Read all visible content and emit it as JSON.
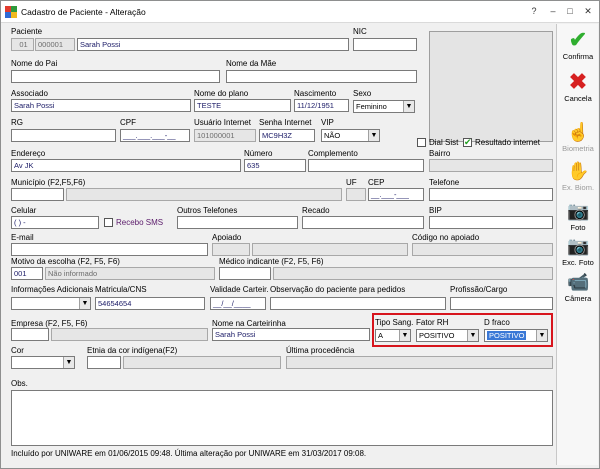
{
  "window": {
    "title": "Cadastro de Paciente - Alteração",
    "help": "?",
    "minimize": "–",
    "maximize": "□",
    "close": "✕"
  },
  "labels": {
    "paciente": "Paciente",
    "nic": "NIC",
    "nome_pai": "Nome do Pai",
    "nome_mae": "Nome da Mãe",
    "associado": "Associado",
    "nome_plano": "Nome do plano",
    "nascimento": "Nascimento",
    "sexo": "Sexo",
    "rg": "RG",
    "cpf": "CPF",
    "usuario_internet": "Usuário Internet",
    "senha_internet": "Senha Internet",
    "vip": "VIP",
    "dial_sist": "Dial Sist",
    "resultado_internet": "Resultado internet",
    "endereco": "Endereço",
    "numero": "Número",
    "complemento": "Complemento",
    "bairro": "Bairro",
    "municipio": "Município (F2,F5,F6)",
    "uf": "UF",
    "cep": "CEP",
    "telefone": "Telefone",
    "celular": "Celular",
    "recebo_sms": "Recebo SMS",
    "outros_telefones": "Outros Telefones",
    "recado": "Recado",
    "bip": "BIP",
    "email": "E-mail",
    "apoiado": "Apoiado",
    "codigo_apoiado": "Código no apoiado",
    "motivo_escolha": "Motivo da escolha (F2, F5, F6)",
    "medico_indicante": "Médico indicante (F2, F5, F6)",
    "info_adicionais": "Informações Adicionais",
    "matricula": "Matricula/CNS",
    "validade": "Validade Carteir.",
    "observacao_pedidos": "Observação do paciente para pedidos",
    "profissao": "Profissão/Cargo",
    "empresa": "Empresa (F2, F5, F6)",
    "nome_carteirinha": "Nome na Carteirinha",
    "tipo_sang": "Tipo Sang.",
    "fator_rh": "Fator RH",
    "d_fraco": "D fraco",
    "cor": "Cor",
    "etnia": "Etnia da cor indígena(F2)",
    "ultima_procedencia": "Última procedência",
    "obs": "Obs."
  },
  "values": {
    "paciente_cod1": "01",
    "paciente_cod2": "000001",
    "paciente_nome": "Sarah Possi",
    "associado": "Sarah Possi",
    "nome_plano": "TESTE",
    "nascimento": "11/12/1951",
    "sexo": "Feminino",
    "cpf": "___.___.___-__",
    "usuario_internet": "101000001",
    "senha_internet": "MC9H3Z",
    "vip": "NÃO",
    "endereco": "Av JK",
    "numero": "635",
    "cep": "__.___-___",
    "celular": "(  )    -",
    "motivo_cod": "001",
    "motivo_desc": "Não informado",
    "matricula": "54654654",
    "validade": "__/__/____",
    "nome_carteirinha": "Sarah Possi",
    "tipo_sang": "A",
    "fator_rh": "POSITIVO",
    "d_fraco": "POSITIVO"
  },
  "sidebar": {
    "confirma": "Confirma",
    "cancela": "Cancela",
    "biometria": "Biometria",
    "ex_biom": "Ex. Biom.",
    "foto": "Foto",
    "exc_foto": "Exc. Foto",
    "camera": "Câmera"
  },
  "footer": "Incluído por UNIWARE em 01/06/2015 09:48. Última alteração por UNIWARE em 31/03/2017 09:08.",
  "colors": {
    "highlight_border": "#d7141c",
    "confirm": "#2fae2f",
    "cancel": "#d62020",
    "selected": "#3a78d6"
  }
}
